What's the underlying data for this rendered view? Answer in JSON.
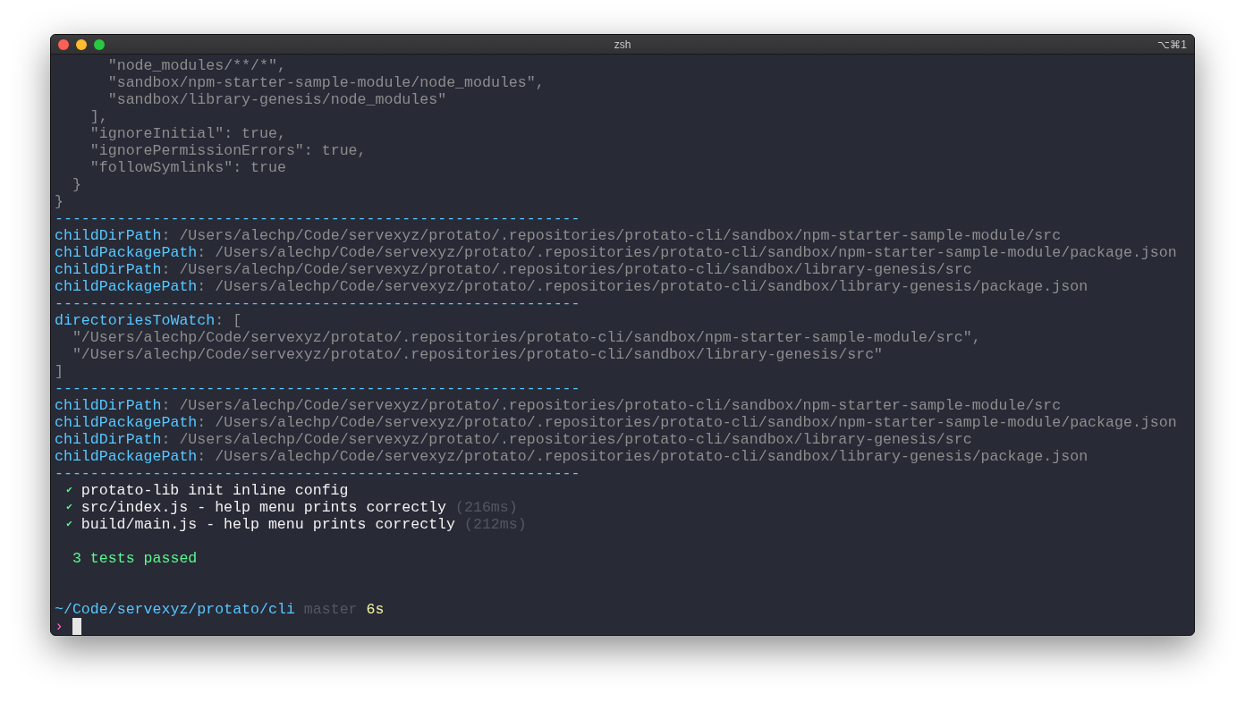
{
  "window": {
    "title": "zsh",
    "shortcut": "⌥⌘1"
  },
  "lines": [
    {
      "kind": "output",
      "segments": [
        {
          "text": "      \"node_modules/**/*\",",
          "kind": "plain"
        }
      ]
    },
    {
      "kind": "output",
      "segments": [
        {
          "text": "      \"sandbox/npm-starter-sample-module/node_modules\",",
          "kind": "plain"
        }
      ]
    },
    {
      "kind": "output",
      "segments": [
        {
          "text": "      \"sandbox/library-genesis/node_modules\"",
          "kind": "plain"
        }
      ]
    },
    {
      "kind": "output",
      "segments": [
        {
          "text": "    ],",
          "kind": "plain"
        }
      ]
    },
    {
      "kind": "output",
      "segments": [
        {
          "text": "    \"ignoreInitial\": true,",
          "kind": "plain"
        }
      ]
    },
    {
      "kind": "output",
      "segments": [
        {
          "text": "    \"ignorePermissionErrors\": true,",
          "kind": "plain"
        }
      ]
    },
    {
      "kind": "output",
      "segments": [
        {
          "text": "    \"followSymlinks\": true",
          "kind": "plain"
        }
      ]
    },
    {
      "kind": "output",
      "segments": [
        {
          "text": "  }",
          "kind": "plain"
        }
      ]
    },
    {
      "kind": "output",
      "segments": [
        {
          "text": "}",
          "kind": "plain"
        }
      ]
    },
    {
      "kind": "output",
      "segments": [
        {
          "text": "-----------------------------------------------------------",
          "kind": "rule"
        }
      ]
    },
    {
      "kind": "output",
      "segments": [
        {
          "text": "childDirPath",
          "kind": "key"
        },
        {
          "text": ": /Users/alechp/Code/servexyz/protato/.repositories/protato-cli/sandbox/npm-starter-sample-module/src",
          "kind": "plain"
        }
      ]
    },
    {
      "kind": "output",
      "segments": [
        {
          "text": "childPackagePath",
          "kind": "key"
        },
        {
          "text": ": /Users/alechp/Code/servexyz/protato/.repositories/protato-cli/sandbox/npm-starter-sample-module/package.json",
          "kind": "plain"
        }
      ]
    },
    {
      "kind": "output",
      "segments": [
        {
          "text": "childDirPath",
          "kind": "key"
        },
        {
          "text": ": /Users/alechp/Code/servexyz/protato/.repositories/protato-cli/sandbox/library-genesis/src",
          "kind": "plain"
        }
      ]
    },
    {
      "kind": "output",
      "segments": [
        {
          "text": "childPackagePath",
          "kind": "key"
        },
        {
          "text": ": /Users/alechp/Code/servexyz/protato/.repositories/protato-cli/sandbox/library-genesis/package.json",
          "kind": "plain"
        }
      ]
    },
    {
      "kind": "output",
      "segments": [
        {
          "text": "-----------------------------------------------------------",
          "kind": "rule"
        }
      ]
    },
    {
      "kind": "output",
      "segments": [
        {
          "text": "directoriesToWatch",
          "kind": "key"
        },
        {
          "text": ": [",
          "kind": "plain"
        }
      ]
    },
    {
      "kind": "output",
      "segments": [
        {
          "text": "  \"/Users/alechp/Code/servexyz/protato/.repositories/protato-cli/sandbox/npm-starter-sample-module/src\",",
          "kind": "plain"
        }
      ]
    },
    {
      "kind": "output",
      "segments": [
        {
          "text": "  \"/Users/alechp/Code/servexyz/protato/.repositories/protato-cli/sandbox/library-genesis/src\"",
          "kind": "plain"
        }
      ]
    },
    {
      "kind": "output",
      "segments": [
        {
          "text": "]",
          "kind": "plain"
        }
      ]
    },
    {
      "kind": "output",
      "segments": [
        {
          "text": "-----------------------------------------------------------",
          "kind": "rule"
        }
      ]
    },
    {
      "kind": "output",
      "segments": [
        {
          "text": "childDirPath",
          "kind": "key"
        },
        {
          "text": ": /Users/alechp/Code/servexyz/protato/.repositories/protato-cli/sandbox/npm-starter-sample-module/src",
          "kind": "plain"
        }
      ]
    },
    {
      "kind": "output",
      "segments": [
        {
          "text": "childPackagePath",
          "kind": "key"
        },
        {
          "text": ": /Users/alechp/Code/servexyz/protato/.repositories/protato-cli/sandbox/npm-starter-sample-module/package.json",
          "kind": "plain"
        }
      ]
    },
    {
      "kind": "output",
      "segments": [
        {
          "text": "childDirPath",
          "kind": "key"
        },
        {
          "text": ": /Users/alechp/Code/servexyz/protato/.repositories/protato-cli/sandbox/library-genesis/src",
          "kind": "plain"
        }
      ]
    },
    {
      "kind": "output",
      "segments": [
        {
          "text": "childPackagePath",
          "kind": "key"
        },
        {
          "text": ": /Users/alechp/Code/servexyz/protato/.repositories/protato-cli/sandbox/library-genesis/package.json",
          "kind": "plain"
        }
      ]
    },
    {
      "kind": "output",
      "segments": [
        {
          "text": "-----------------------------------------------------------",
          "kind": "rule"
        }
      ]
    },
    {
      "kind": "output",
      "segments": [
        {
          "text": "  ✔",
          "kind": "check"
        },
        {
          "text": " protato-lib init inline config",
          "kind": "bright"
        }
      ]
    },
    {
      "kind": "output",
      "segments": [
        {
          "text": "  ✔",
          "kind": "check"
        },
        {
          "text": " src/index.js - help menu prints correctly",
          "kind": "bright"
        },
        {
          "text": " (216ms)",
          "kind": "dim"
        }
      ]
    },
    {
      "kind": "output",
      "segments": [
        {
          "text": "  ✔",
          "kind": "check"
        },
        {
          "text": " build/main.js - help menu prints correctly",
          "kind": "bright"
        },
        {
          "text": " (212ms)",
          "kind": "dim"
        }
      ]
    },
    {
      "kind": "blank"
    },
    {
      "kind": "output",
      "segments": [
        {
          "text": "  3 tests passed",
          "kind": "pass"
        }
      ]
    },
    {
      "kind": "blank"
    },
    {
      "kind": "blank"
    },
    {
      "kind": "output",
      "segments": [
        {
          "text": "~/Code/servexyz/protato/cli",
          "kind": "key"
        },
        {
          "text": " master",
          "kind": "dim"
        },
        {
          "text": " 6s",
          "kind": "duration"
        }
      ]
    },
    {
      "kind": "input",
      "segments": [
        {
          "text": "›",
          "kind": "prompt"
        }
      ]
    }
  ]
}
